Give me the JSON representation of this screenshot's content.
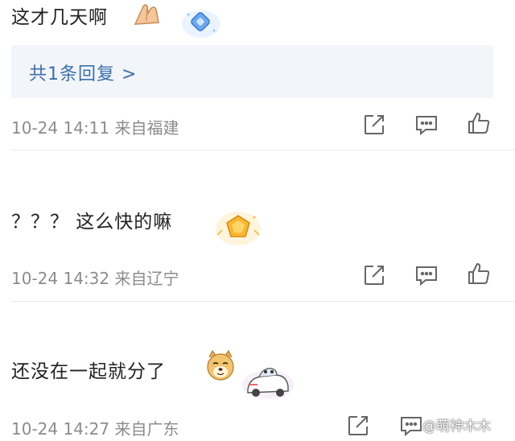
{
  "comments": [
    {
      "text": "这才几天啊",
      "emoji_icon": "hands-together-emoji",
      "badge_icon": "blue-diamond-badge",
      "meta_time": "10-24 14:11",
      "meta_location": "来自福建",
      "reply_link": "共1条回复 >"
    },
    {
      "text": "？？？ 这么快的嘛",
      "badge_icon": "gold-medal-badge",
      "meta_time": "10-24 14:32",
      "meta_location": "来自辽宁"
    },
    {
      "text": "还没在一起就分了",
      "emoji_icon": "doge-emoji",
      "badge_icon": "cartoon-car-badge",
      "meta_time": "10-24 14:27",
      "meta_location": "来自广东"
    }
  ],
  "actions": [
    "share-icon",
    "comment-icon",
    "like-icon"
  ],
  "watermark": "@萌神木木",
  "colors": {
    "link": "#3b6fae",
    "meta": "#8c8c8c",
    "icon": "#666666",
    "reply_bg": "#f2f5f9"
  }
}
